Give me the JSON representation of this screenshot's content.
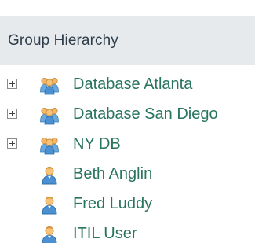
{
  "header": {
    "title": "Group Hierarchy"
  },
  "tree": {
    "groups": [
      {
        "label": "Database Atlanta",
        "icon": "group-icon",
        "expander": "plus"
      },
      {
        "label": "Database San Diego",
        "icon": "group-icon",
        "expander": "plus"
      },
      {
        "label": "NY DB",
        "icon": "group-icon",
        "expander": "plus"
      }
    ],
    "users": [
      {
        "label": "Beth Anglin",
        "icon": "user-icon"
      },
      {
        "label": "Fred Luddy",
        "icon": "user-icon"
      },
      {
        "label": "ITIL User",
        "icon": "user-icon"
      }
    ]
  },
  "colors": {
    "header_bg": "#e7eaed",
    "header_text": "#2e3d49",
    "link": "#28745f",
    "icon_blue": "#5b9bd5",
    "icon_orange": "#f0a030"
  }
}
